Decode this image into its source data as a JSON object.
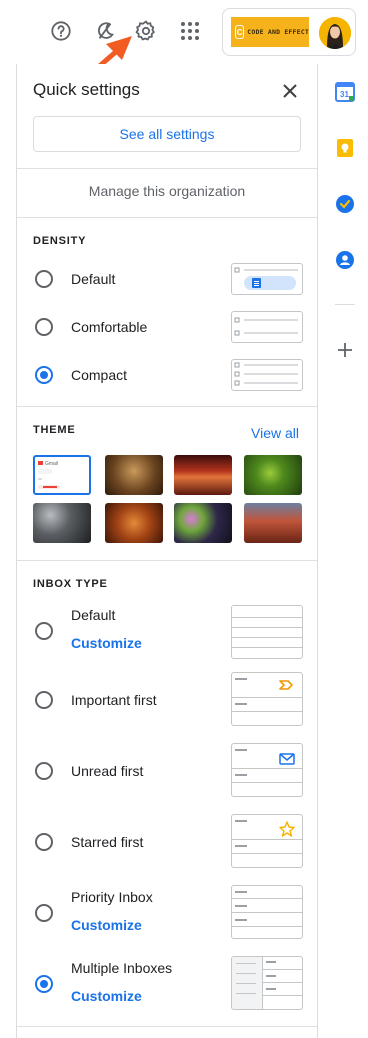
{
  "header": {
    "brand_text": "CODE AND EFFECT",
    "brand_mark": "C",
    "icons": [
      "help-icon",
      "dark-mode-icon",
      "gear-icon",
      "apps-grid-icon"
    ]
  },
  "quick_settings": {
    "title": "Quick settings",
    "see_all": "See all settings",
    "manage": "Manage this organization"
  },
  "density": {
    "heading": "DENSITY",
    "options": [
      {
        "label": "Default",
        "selected": false
      },
      {
        "label": "Comfortable",
        "selected": false
      },
      {
        "label": "Compact",
        "selected": true
      }
    ]
  },
  "theme": {
    "heading": "THEME",
    "view_all": "View all",
    "thumb_label": "Gmail"
  },
  "inbox_type": {
    "heading": "INBOX TYPE",
    "options": [
      {
        "label": "Default",
        "link": "Customize",
        "selected": false
      },
      {
        "label": "Important first",
        "link": "",
        "selected": false
      },
      {
        "label": "Unread first",
        "link": "",
        "selected": false
      },
      {
        "label": "Starred first",
        "link": "",
        "selected": false
      },
      {
        "label": "Priority Inbox",
        "link": "Customize",
        "selected": false
      },
      {
        "label": "Multiple Inboxes",
        "link": "Customize",
        "selected": true
      }
    ]
  },
  "rail": {
    "calendar_day": "31"
  },
  "colors": {
    "accent": "#1a73e8",
    "annotation_arrow": "#f25c22",
    "brand": "#f6b21a"
  }
}
